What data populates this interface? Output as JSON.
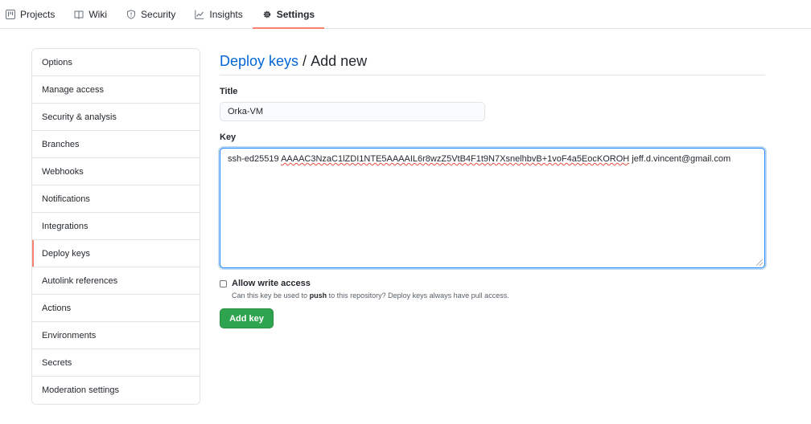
{
  "nav": {
    "tabs": [
      {
        "label": "Projects",
        "icon": "project-icon"
      },
      {
        "label": "Wiki",
        "icon": "book-icon"
      },
      {
        "label": "Security",
        "icon": "shield-icon"
      },
      {
        "label": "Insights",
        "icon": "graph-icon"
      },
      {
        "label": "Settings",
        "icon": "gear-icon",
        "active": true
      }
    ]
  },
  "sidebar": {
    "items": [
      {
        "label": "Options"
      },
      {
        "label": "Manage access"
      },
      {
        "label": "Security & analysis"
      },
      {
        "label": "Branches"
      },
      {
        "label": "Webhooks"
      },
      {
        "label": "Notifications"
      },
      {
        "label": "Integrations"
      },
      {
        "label": "Deploy keys",
        "selected": true
      },
      {
        "label": "Autolink references"
      },
      {
        "label": "Actions"
      },
      {
        "label": "Environments"
      },
      {
        "label": "Secrets"
      },
      {
        "label": "Moderation settings"
      }
    ]
  },
  "main": {
    "heading_link": "Deploy keys",
    "heading_sep": "/",
    "heading_sub": "Add new",
    "title_label": "Title",
    "title_value": "Orka-VM",
    "key_label": "Key",
    "key_prefix": "ssh-ed25519",
    "key_body": "AAAAC3NzaC1lZDI1NTE5AAAAIL6r8wzZ5VtB4F1t9N7XsnelhbvB+1voF4a5EocKOROH",
    "key_suffix": "jeff.d.vincent@gmail.com",
    "allow_write_label": "Allow write access",
    "allow_write_note_pre": "Can this key be used to",
    "allow_write_note_bold": "push",
    "allow_write_note_post": "to this repository? Deploy keys always have pull access.",
    "allow_write_checked": false,
    "submit_label": "Add key"
  },
  "colors": {
    "accent_tab": "#f9826c",
    "link": "#0366d6",
    "button": "#2ea44f"
  }
}
